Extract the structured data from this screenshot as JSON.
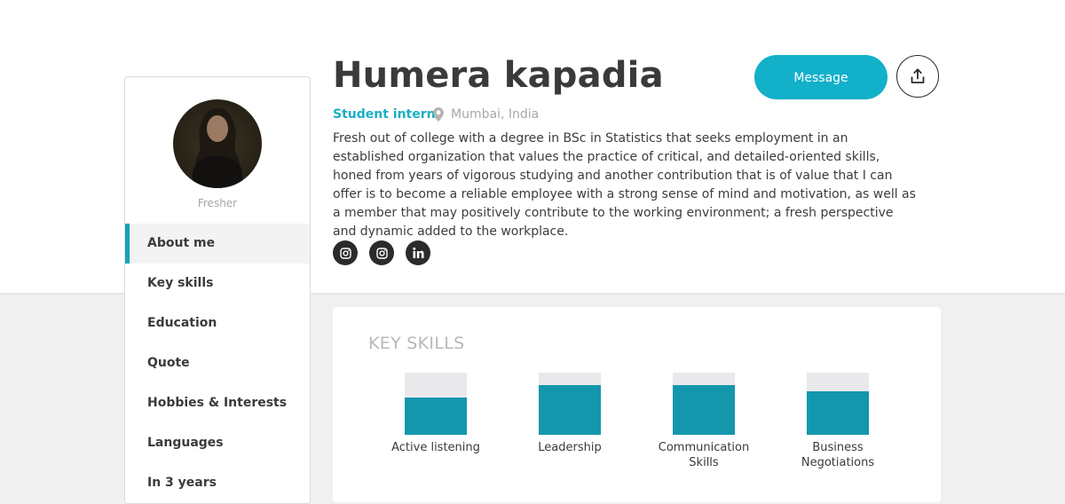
{
  "profile": {
    "name": "Humera kapadia",
    "role": "Student intern",
    "location": "Mumbai, India",
    "status": "Fresher",
    "bio": "Fresh out of college with a degree in BSc in Statistics that seeks employment in an established organization that values the practice of critical, and detailed-oriented skills, honed from years of vigorous studying and another contribution that is of value that I can offer is to become a reliable employee with a strong sense of mind and motivation, as well as a member that may positively contribute to the working environment; a fresh perspective and dynamic added to the workplace."
  },
  "actions": {
    "message_label": "Message",
    "share_icon": "share-icon"
  },
  "social": [
    {
      "icon": "instagram-icon"
    },
    {
      "icon": "instagram-icon"
    },
    {
      "icon": "linkedin-icon",
      "text": "in"
    }
  ],
  "sidebar": {
    "items": [
      {
        "label": "About me",
        "active": true
      },
      {
        "label": "Key skills"
      },
      {
        "label": "Education"
      },
      {
        "label": "Quote"
      },
      {
        "label": "Hobbies & Interests"
      },
      {
        "label": "Languages"
      },
      {
        "label": "In 3 years"
      }
    ]
  },
  "skills": {
    "title": "KEY SKILLS",
    "items": [
      {
        "label": "Active listening",
        "level": 0.6
      },
      {
        "label": "Leadership",
        "level": 0.8
      },
      {
        "label": "Communication Skills",
        "level": 0.8
      },
      {
        "label": "Business Negotiations",
        "level": 0.7
      }
    ]
  },
  "colors": {
    "accent": "#12b0c9",
    "role_text": "#19b0c4",
    "skill_fill": "#1497ad",
    "skill_track": "#e9e9ec",
    "social_bg": "#2b2b2b"
  }
}
